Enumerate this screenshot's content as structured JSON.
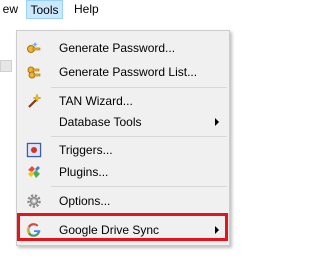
{
  "menubar": {
    "view_partial": "ew",
    "tools": "Tools",
    "help": "Help"
  },
  "tools_menu": {
    "items": [
      {
        "label": "Generate Password...",
        "icon": "password-generator-icon",
        "submenu": false
      },
      {
        "label": "Generate Password List...",
        "icon": "password-list-icon",
        "submenu": false
      },
      {
        "label": "TAN Wizard...",
        "icon": "magic-wand-icon",
        "submenu": false
      },
      {
        "label": "Database Tools",
        "icon": "",
        "submenu": true
      },
      {
        "label": "Triggers...",
        "icon": "triggers-icon",
        "submenu": false
      },
      {
        "label": "Plugins...",
        "icon": "plugins-icon",
        "submenu": false
      },
      {
        "label": "Options...",
        "icon": "options-gear-icon",
        "submenu": false
      },
      {
        "label": "Google Drive Sync",
        "icon": "google-icon",
        "submenu": true
      }
    ]
  },
  "colors": {
    "menu_bg": "#f0f0f0",
    "menubar_active": "#cce8ff",
    "highlight_border": "#e3141b",
    "google_blue": "#4285f4",
    "google_red": "#ea4335",
    "google_yellow": "#fbbc05",
    "google_green": "#34a853"
  }
}
